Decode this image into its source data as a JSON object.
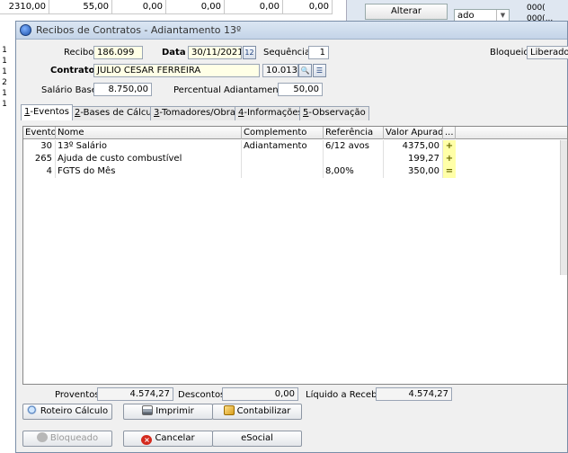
{
  "background": {
    "row_values": [
      "2310,00",
      "55,00",
      "0,00",
      "0,00",
      "0,00",
      "0,00"
    ],
    "side_digits": [
      "1",
      "1",
      "1",
      "2",
      "1",
      "1"
    ],
    "alterar_label": "Alterar",
    "combo_value": "ado",
    "corner_text": "000(",
    "corner_text2": "000(..."
  },
  "dialog": {
    "title": "Recibos de Contratos - Adiantamento 13º"
  },
  "form": {
    "recibo_label": "Recibo",
    "recibo_value": "186.099",
    "data_label": "Data",
    "data_value": "30/11/2021",
    "calendar_icon_text": "12",
    "sequencia_label": "Sequência",
    "sequencia_value": "1",
    "bloqueio_label": "Bloqueio",
    "bloqueio_value": "Liberado",
    "contrato_label": "Contrato",
    "contrato_name": "JULIO CESAR FERREIRA",
    "contrato_code": "10.013",
    "salario_label": "Salário Base",
    "salario_value": "8.750,00",
    "percentual_label": "Percentual Adiantamento",
    "percentual_value": "50,00"
  },
  "tabs": [
    {
      "key": "1",
      "label": "-Eventos"
    },
    {
      "key": "2",
      "label": "-Bases de Cálculo"
    },
    {
      "key": "3",
      "label": "-Tomadores/Obras"
    },
    {
      "key": "4",
      "label": "-Informações"
    },
    {
      "key": "5",
      "label": "-Observação"
    }
  ],
  "grid": {
    "headers": [
      "Evento",
      "Nome",
      "Complemento",
      "Referência",
      "Valor Apurado",
      "..."
    ],
    "rows": [
      {
        "evento": "30",
        "nome": "13º Salário",
        "complemento": "Adiantamento",
        "referencia": "6/12 avos",
        "valor": "4375,00",
        "sign": "+"
      },
      {
        "evento": "265",
        "nome": "Ajuda de custo combustível",
        "complemento": "",
        "referencia": "",
        "valor": "199,27",
        "sign": "+"
      },
      {
        "evento": "4",
        "nome": "FGTS do Mês",
        "complemento": "",
        "referencia": "8,00%",
        "valor": "350,00",
        "sign": "="
      }
    ]
  },
  "totals": {
    "proventos_label": "Proventos",
    "proventos_value": "4.574,27",
    "descontos_label": "Descontos",
    "descontos_value": "0,00",
    "liquido_label": "Líquido a Receber",
    "liquido_value": "4.574,27"
  },
  "buttons": {
    "roteiro": "Roteiro Cálculo",
    "imprimir": "Imprimir",
    "contabilizar": "Contabilizar",
    "bloqueado": "Bloqueado",
    "cancelar": "Cancelar",
    "esocial": "eSocial"
  },
  "colors": {
    "title_bar": "#c4d4e8",
    "sign_bg": "#ffffa8",
    "cancel_icon": "#d42a1e"
  }
}
